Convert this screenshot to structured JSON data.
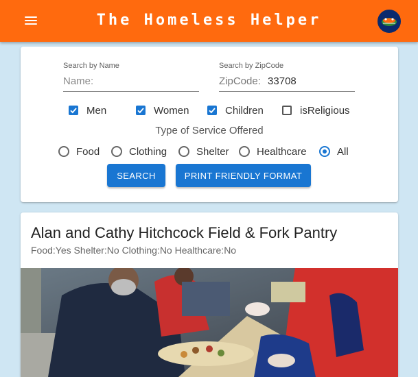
{
  "header": {
    "title": "The Homeless Helper"
  },
  "search": {
    "name_label": "Search by Name",
    "name_placeholder": "Name:",
    "zip_label": "Search by ZipCode",
    "zip_prefix": "ZipCode:",
    "zip_value": "33708"
  },
  "filters": {
    "checkboxes": [
      {
        "label": "Men",
        "checked": true
      },
      {
        "label": "Women",
        "checked": true
      },
      {
        "label": "Children",
        "checked": true
      },
      {
        "label": "isReligious",
        "checked": false
      }
    ],
    "service_title": "Type of Service Offered",
    "radios": [
      {
        "label": "Food",
        "selected": false
      },
      {
        "label": "Clothing",
        "selected": false
      },
      {
        "label": "Shelter",
        "selected": false
      },
      {
        "label": "Healthcare",
        "selected": false
      },
      {
        "label": "All",
        "selected": true
      }
    ]
  },
  "buttons": {
    "search": "SEARCH",
    "print": "PRINT FRIENDLY FORMAT"
  },
  "results": [
    {
      "name": "Alan and Cathy Hitchcock Field & Fork Pantry",
      "services": "Food:Yes Shelter:No Clothing:No Healthcare:No"
    }
  ],
  "colors": {
    "appbar": "#ff6a0e",
    "primary": "#1976d2",
    "background": "#cfe6f3"
  },
  "icons": {
    "menu": "hamburger-menu-icon",
    "logo": "florida-gators-logo",
    "checkbox": "check-icon"
  }
}
